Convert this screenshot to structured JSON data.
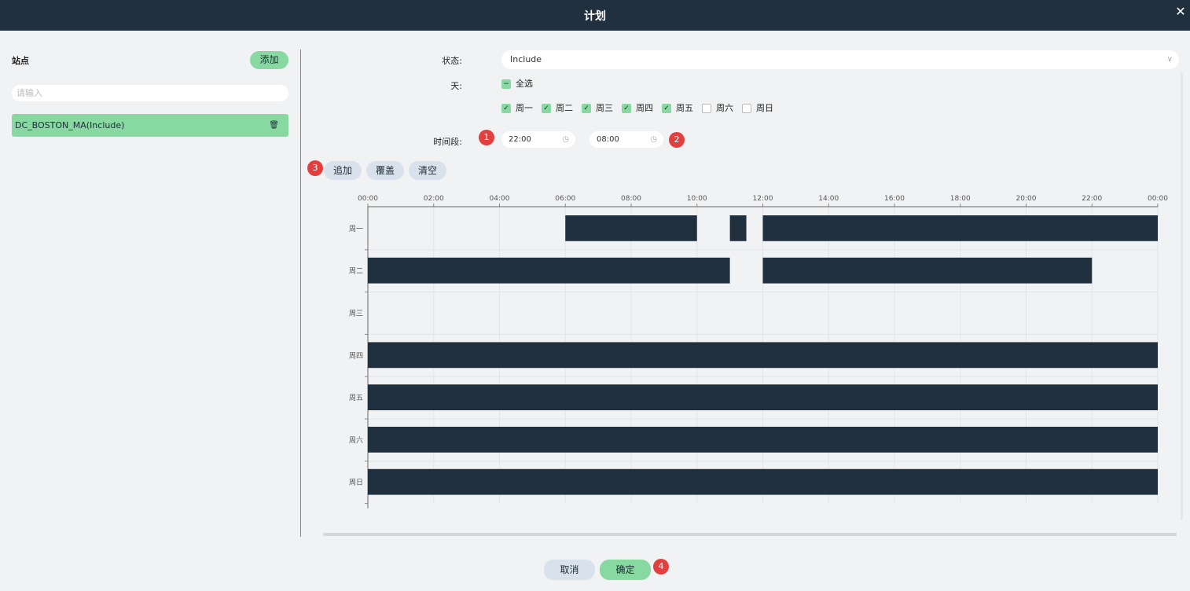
{
  "header": {
    "title": "计划",
    "close_icon": "close-icon"
  },
  "left": {
    "label": "站点",
    "add_label": "添加",
    "search_placeholder": "请输入",
    "site_name": "DC_BOSTON_MA(Include)",
    "trash_icon": "trash-icon"
  },
  "form": {
    "status_label": "状态:",
    "status_value": "Include",
    "day_label": "天:",
    "select_all_label": "全选",
    "days": [
      {
        "label": "周一",
        "checked": true
      },
      {
        "label": "周二",
        "checked": true
      },
      {
        "label": "周三",
        "checked": true
      },
      {
        "label": "周四",
        "checked": true
      },
      {
        "label": "周五",
        "checked": true
      },
      {
        "label": "周六",
        "checked": false
      },
      {
        "label": "周日",
        "checked": false
      }
    ],
    "time_label": "时间段:",
    "start_time": "22:00",
    "end_time": "08:00"
  },
  "actions": {
    "append": "追加",
    "overwrite": "覆盖",
    "clear": "清空"
  },
  "badges": [
    "1",
    "2",
    "3",
    "4"
  ],
  "footer": {
    "cancel": "取消",
    "confirm": "确定"
  },
  "chart_data": {
    "type": "gantt",
    "x_ticks": [
      "00:00",
      "02:00",
      "04:00",
      "06:00",
      "08:00",
      "10:00",
      "12:00",
      "14:00",
      "16:00",
      "18:00",
      "20:00",
      "22:00",
      "00:00"
    ],
    "x_range": [
      0,
      24
    ],
    "categories": [
      "周一",
      "周二",
      "周三",
      "周四",
      "周五",
      "周六",
      "周日"
    ],
    "bar_color": "#21303f",
    "bars": [
      {
        "day": "周一",
        "start": 6,
        "end": 10
      },
      {
        "day": "周一",
        "start": 11,
        "end": 11.5
      },
      {
        "day": "周一",
        "start": 12,
        "end": 24
      },
      {
        "day": "周二",
        "start": 0,
        "end": 11
      },
      {
        "day": "周二",
        "start": 12,
        "end": 22
      },
      {
        "day": "周四",
        "start": 0,
        "end": 24
      },
      {
        "day": "周五",
        "start": 0,
        "end": 24
      },
      {
        "day": "周六",
        "start": 0,
        "end": 24
      },
      {
        "day": "周日",
        "start": 0,
        "end": 24
      }
    ]
  }
}
